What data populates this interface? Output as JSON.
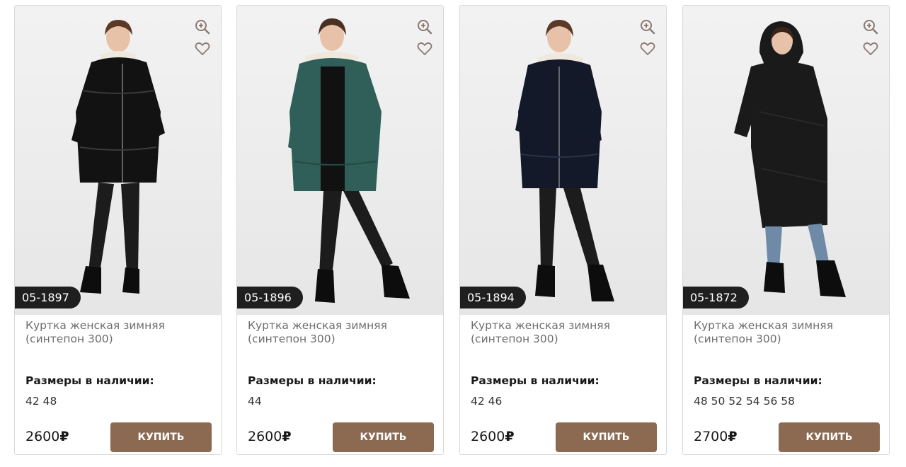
{
  "colors": {
    "accent_button": "#8c6a51",
    "sku_badge": "#1f1f1f",
    "icon": "#8c7a6e"
  },
  "products": [
    {
      "sku": "05-1897",
      "title": "Куртка женская зимняя (синтепон 300)",
      "sizes_label": "Размеры в наличии:",
      "sizes": "42 48",
      "price": "2600",
      "currency": "₽",
      "buy_label": "КУПИТЬ",
      "coat_color": "#121212",
      "zoom_icon": "zoom-in-icon",
      "fav_icon": "heart-icon"
    },
    {
      "sku": "05-1896",
      "title": "Куртка женская зимняя (синтепон 300)",
      "sizes_label": "Размеры в наличии:",
      "sizes": "44",
      "price": "2600",
      "currency": "₽",
      "buy_label": "КУПИТЬ",
      "coat_color": "#2f5f58",
      "zoom_icon": "zoom-in-icon",
      "fav_icon": "heart-icon"
    },
    {
      "sku": "05-1894",
      "title": "Куртка женская зимняя (синтепон 300)",
      "sizes_label": "Размеры в наличии:",
      "sizes": "42 46",
      "price": "2600",
      "currency": "₽",
      "buy_label": "КУПИТЬ",
      "coat_color": "#14192a",
      "zoom_icon": "zoom-in-icon",
      "fav_icon": "heart-icon"
    },
    {
      "sku": "05-1872",
      "title": "Куртка женская зимняя (синтепон 300)",
      "sizes_label": "Размеры в наличии:",
      "sizes": "48 50 52 54 56 58",
      "price": "2700",
      "currency": "₽",
      "buy_label": "КУПИТЬ",
      "coat_color": "#1a1a1a",
      "zoom_icon": "zoom-in-icon",
      "fav_icon": "heart-icon"
    }
  ]
}
